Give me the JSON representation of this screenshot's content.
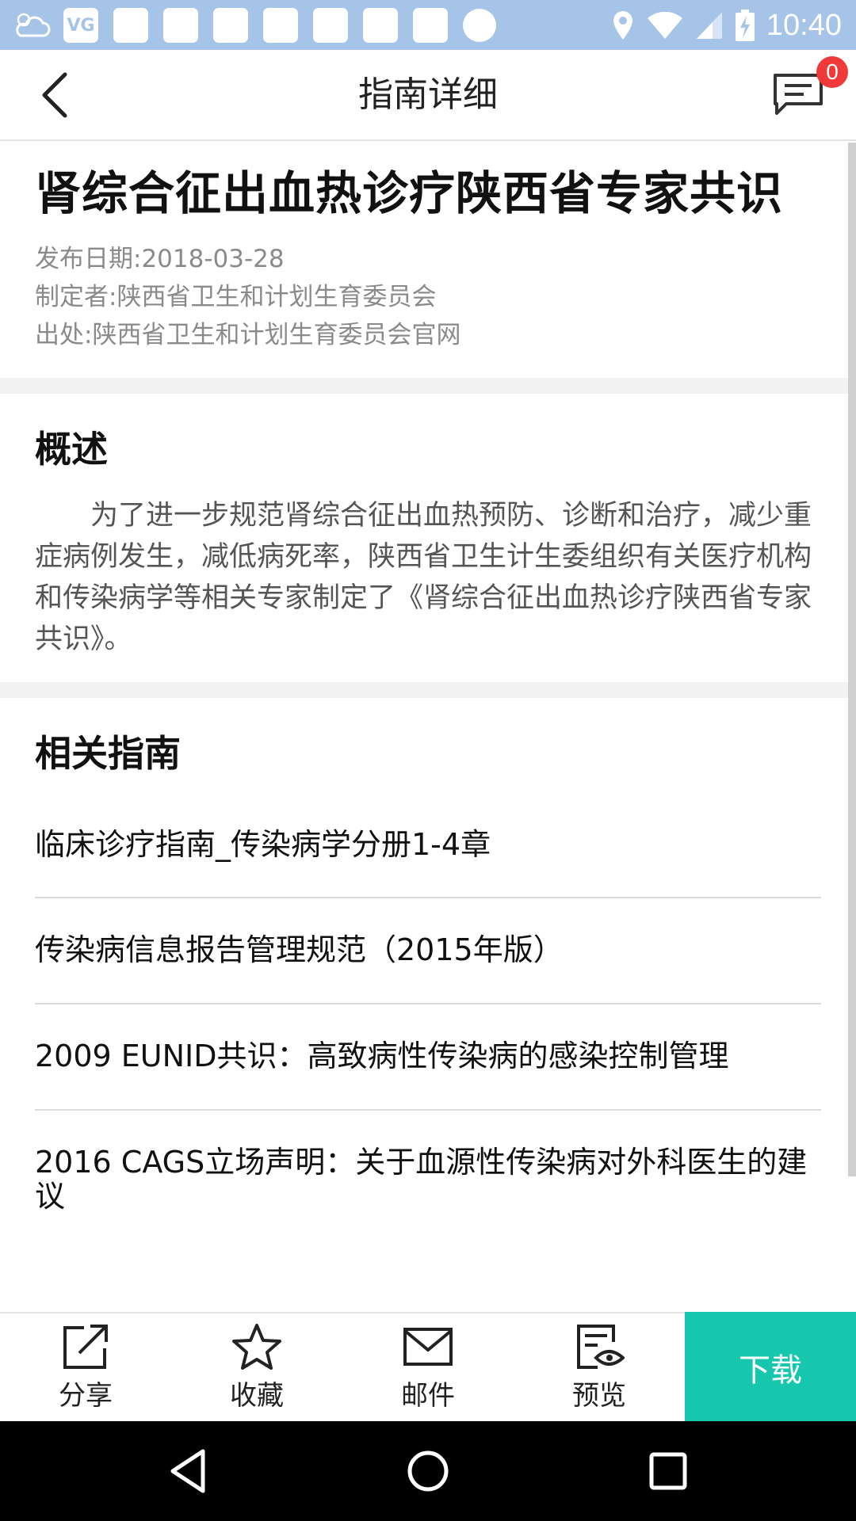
{
  "status_bar": {
    "time": "10:40",
    "app_badge": "VG",
    "icons": [
      "weather-cloud-icon",
      "vg-app-icon",
      "app-icon",
      "app-icon",
      "app-icon",
      "app-icon",
      "app-icon",
      "app-icon",
      "app-icon",
      "dot-icon",
      "location-icon",
      "wifi-icon",
      "signal-icon",
      "battery-charging-icon"
    ]
  },
  "header": {
    "title": "指南详细",
    "message_count": "0"
  },
  "guide": {
    "title": "肾综合征出血热诊疗陕西省专家共识",
    "publish_date": "发布日期:2018-03-28",
    "author": "制定者:陕西省卫生和计划生育委员会",
    "source": "出处:陕西省卫生和计划生育委员会官网"
  },
  "summary": {
    "heading": "概述",
    "text": "为了进一步规范肾综合征出血热预防、诊断和治疗，减少重症病例发生，减低病死率，陕西省卫生计生委组织有关医疗机构和传染病学等相关专家制定了《肾综合征出血热诊疗陕西省专家共识》。"
  },
  "related": {
    "heading": "相关指南",
    "items": [
      "临床诊疗指南_传染病学分册1-4章",
      "传染病信息报告管理规范（2015年版）",
      "2009 EUNID共识：高致病性传染病的感染控制管理",
      "2016 CAGS立场声明：关于血源性传染病对外科医生的建议"
    ]
  },
  "toolbar": {
    "share": "分享",
    "favorite": "收藏",
    "mail": "邮件",
    "preview": "预览",
    "download": "下载"
  },
  "colors": {
    "status_bar": "#a6c3e8",
    "accent": "#17c7ad",
    "badge": "#f03a3a"
  }
}
